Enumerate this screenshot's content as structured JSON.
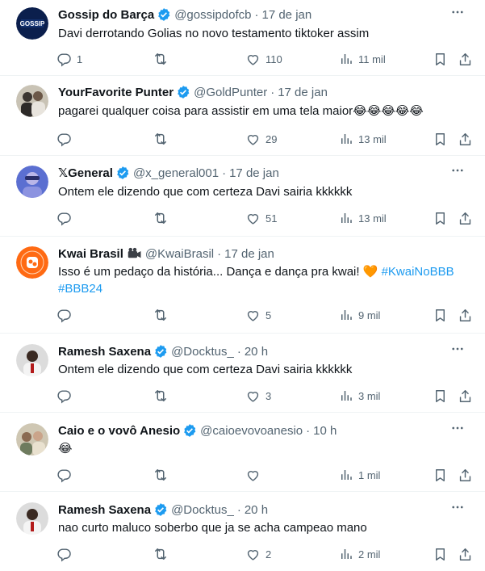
{
  "tweets": [
    {
      "name": "Gossip do Barça",
      "avatar_text": "GOSSIP",
      "handle": "@gossipdofcb",
      "time": "17 de jan",
      "text": "Davi derrotando Golias no novo testamento tiktoker assim",
      "replies": "1",
      "retweets": "",
      "likes": "110",
      "views": "11 mil"
    },
    {
      "name": "YourFavorite Punter",
      "handle": "@GoldPunter",
      "time": "17 de jan",
      "text": "pagarei qualquer coisa para assistir em uma tela maior",
      "emoji": "😂😂😂😂😂",
      "replies": "",
      "retweets": "",
      "likes": "29",
      "views": "13 mil"
    },
    {
      "name": "𝕏General",
      "handle": "@x_general001",
      "time": "17 de jan",
      "text": "Ontem ele dizendo que com certeza Davi sairia kkkkkk",
      "replies": "",
      "retweets": "",
      "likes": "51",
      "views": "13 mil"
    },
    {
      "name": "Kwai Brasil",
      "handle": "@KwaiBrasil",
      "time": "17 de jan",
      "text": "Isso é um pedaço da história... Dança e dança pra kwai!",
      "emoji": "🧡",
      "hashtag1": "#KwaiNoBBB",
      "hashtag2": "#BBB24",
      "replies": "",
      "retweets": "",
      "likes": "5",
      "views": "9 mil"
    },
    {
      "name": "Ramesh Saxena",
      "handle": "@Docktus_",
      "time": "20 h",
      "text": "Ontem ele dizendo que com certeza Davi sairia kkkkkk",
      "replies": "",
      "retweets": "",
      "likes": "3",
      "views": "3 mil"
    },
    {
      "name": "Caio e o vovô Anesio",
      "handle": "@caioevovoanesio",
      "time": "10 h",
      "text": "",
      "emoji": "😂",
      "replies": "",
      "retweets": "",
      "likes": "",
      "views": "1 mil"
    },
    {
      "name": "Ramesh Saxena",
      "handle": "@Docktus_",
      "time": "20 h",
      "text": "nao curto maluco soberbo que ja se acha campeao mano",
      "replies": "",
      "retweets": "",
      "likes": "2",
      "views": "2 mil"
    }
  ],
  "colors": {
    "text": "#0f1419",
    "secondary": "#536471",
    "verified": "#1d9bf0",
    "hashtag": "#1d9bf0",
    "divider": "#eff3f4",
    "kwai": "#ff6a13"
  },
  "icons": [
    "reply-icon",
    "retweet-icon",
    "like-icon",
    "views-icon",
    "bookmark-icon",
    "share-icon",
    "more-icon",
    "verified-badge-icon",
    "camera-icon"
  ]
}
